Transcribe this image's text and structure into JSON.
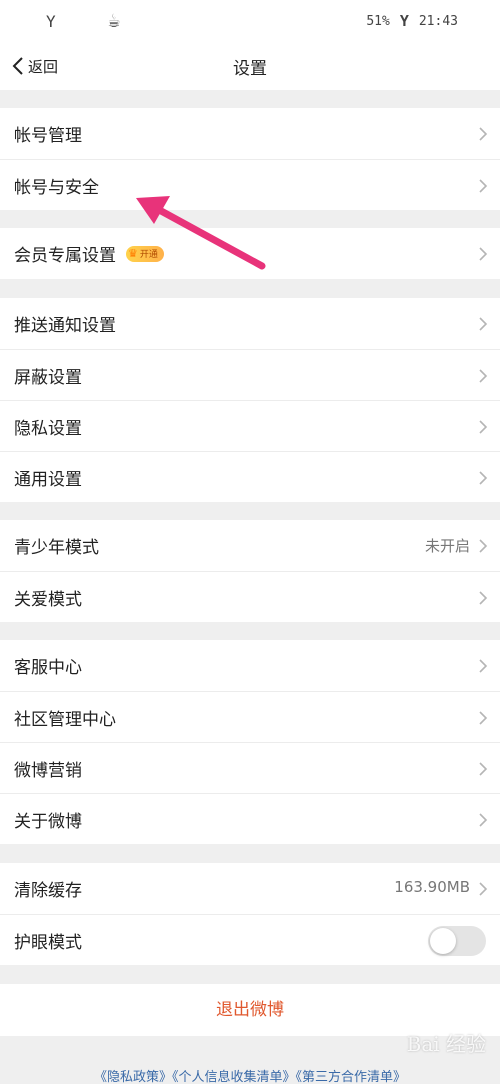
{
  "status_bar": {
    "battery": "51%",
    "time": "21:43",
    "left_icons": [
      "signal-icon",
      "coffee-icon"
    ]
  },
  "nav": {
    "back_label": "返回",
    "title": "设置"
  },
  "groups": [
    {
      "items": [
        {
          "label": "帐号管理"
        },
        {
          "label": "帐号与安全"
        }
      ]
    },
    {
      "items": [
        {
          "label": "会员专属设置",
          "badge": "开通"
        }
      ]
    },
    {
      "items": [
        {
          "label": "推送通知设置"
        },
        {
          "label": "屏蔽设置"
        },
        {
          "label": "隐私设置"
        },
        {
          "label": "通用设置"
        }
      ]
    },
    {
      "items": [
        {
          "label": "青少年模式",
          "value": "未开启"
        },
        {
          "label": "关爱模式"
        }
      ]
    },
    {
      "items": [
        {
          "label": "客服中心"
        },
        {
          "label": "社区管理中心"
        },
        {
          "label": "微博营销"
        },
        {
          "label": "关于微博"
        }
      ]
    },
    {
      "items": [
        {
          "label": "清除缓存",
          "value": "163.90MB"
        },
        {
          "label": "护眼模式",
          "toggle": false
        }
      ]
    }
  ],
  "logout_label": "退出微博",
  "footer_links": [
    "《隐私政策》",
    "《个人信息收集清单》",
    "《第三方合作清单》"
  ],
  "watermark_text": "Bai 经验",
  "colors": {
    "accent_logout": "#e0582e",
    "annotation_arrow": "#e8337a",
    "link": "#3a6aa8"
  }
}
